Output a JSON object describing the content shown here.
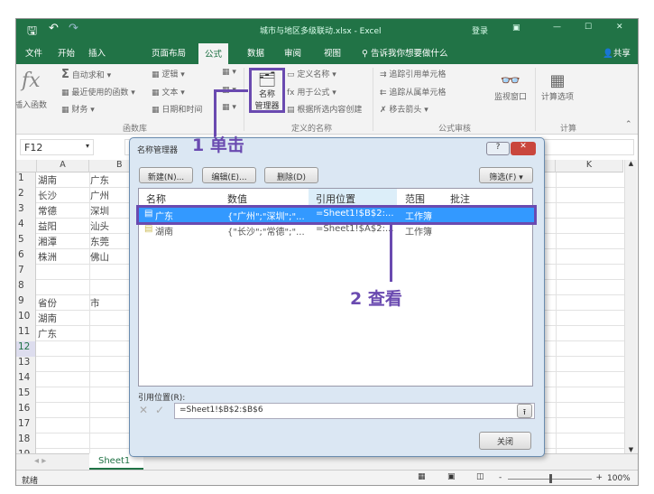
{
  "window": {
    "title": "城市与地区多级联动.xlsx - Excel",
    "login": "登录",
    "share": "共享"
  },
  "tabs": [
    "文件",
    "开始",
    "插入",
    "页面布局",
    "公式",
    "数据",
    "审阅",
    "视图"
  ],
  "tell_me": "告诉我你想要做什么",
  "ribbon": {
    "insert_function": "插入函数",
    "autosum": "自动求和",
    "recent": "最近使用的函数",
    "finance": "财务",
    "logic": "逻辑",
    "text": "文本",
    "datetime": "日期和时间",
    "group_lib": "函数库",
    "name_manager": [
      "名称",
      "管理器"
    ],
    "define_name": "定义名称",
    "use_in_formula": "用于公式",
    "create_from_sel": "根据所选内容创建",
    "group_names": "定义的名称",
    "trace_precedents": "追踪引用单元格",
    "trace_dependents": "追踪从属单元格",
    "remove_arrows": "移去箭头",
    "group_audit": "公式审核",
    "watch": "监视窗口",
    "calc_options": "计算选项",
    "group_calc": "计算"
  },
  "name_box": "F12",
  "columns": [
    "A",
    "B",
    "K"
  ],
  "rows": [
    [
      "湖南",
      "广东"
    ],
    [
      "长沙",
      "广州"
    ],
    [
      "常德",
      "深圳"
    ],
    [
      "益阳",
      "汕头"
    ],
    [
      "湘潭",
      "东莞"
    ],
    [
      "株洲",
      "佛山"
    ],
    [
      "",
      ""
    ],
    [
      "",
      ""
    ],
    [
      "省份",
      "市"
    ],
    [
      "湖南",
      ""
    ],
    [
      "广东",
      ""
    ],
    [
      "",
      ""
    ],
    [
      "",
      ""
    ],
    [
      "",
      ""
    ],
    [
      "",
      ""
    ],
    [
      "",
      ""
    ],
    [
      "",
      ""
    ],
    [
      "",
      ""
    ],
    [
      "",
      ""
    ]
  ],
  "sheet_tab": "Sheet1",
  "status": {
    "ready": "就绪",
    "zoom": "100%"
  },
  "dialog": {
    "title": "名称管理器",
    "new": "新建(N)...",
    "edit": "编辑(E)...",
    "delete": "删除(D)",
    "filter": "筛选(F) ▾",
    "headers": [
      "名称",
      "数值",
      "引用位置",
      "范围",
      "批注"
    ],
    "items": [
      {
        "name": "广东",
        "value": "{\"广州\";\"深圳\";\"...",
        "ref": "=Sheet1!$B$2:...",
        "scope": "工作簿",
        "selected": true
      },
      {
        "name": "湖南",
        "value": "{\"长沙\";\"常德\";\"...",
        "ref": "=Sheet1!$A$2:...",
        "scope": "工作簿",
        "selected": false
      }
    ],
    "ref_label": "引用位置(R):",
    "ref_value": "=Sheet1!$B$2:$B$6",
    "close": "关闭"
  },
  "annotations": {
    "step1": "1 单击",
    "step2": "2 查看"
  },
  "colors": {
    "excel_green": "#217346",
    "annotation": "#6a4ab0",
    "selection": "#3399ff"
  }
}
